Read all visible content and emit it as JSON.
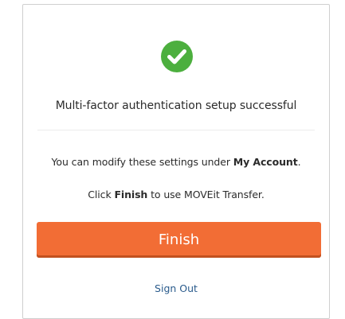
{
  "dialog": {
    "status_icon": "success-check-icon",
    "title": "Multi-factor authentication setup successful",
    "modify_text_before": "You can modify these settings under ",
    "modify_text_bold": "My Account",
    "modify_text_after": ".",
    "finish_text_before": "Click ",
    "finish_text_bold": "Finish",
    "finish_text_after": " to use MOVEit Transfer.",
    "finish_button_label": "Finish",
    "sign_out_label": "Sign Out"
  },
  "colors": {
    "success_green": "#4caf3e",
    "button_orange": "#f26d35",
    "link_blue": "#2a5b8c"
  }
}
